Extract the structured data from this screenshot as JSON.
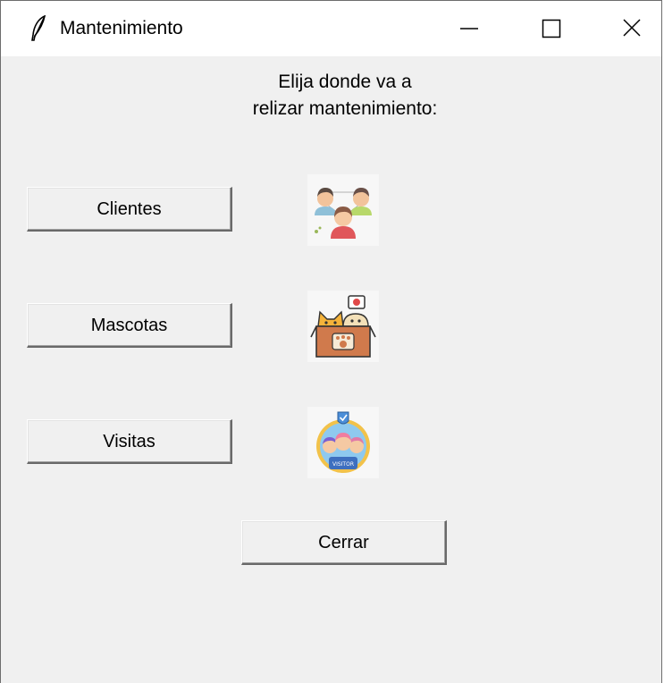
{
  "window": {
    "title": "Mantenimiento",
    "controls": [
      "minimize",
      "maximize",
      "close"
    ]
  },
  "prompt": {
    "text": "Elija donde va a\nrelizar mantenimiento:"
  },
  "buttons": {
    "clientes": "Clientes",
    "mascotas": "Mascotas",
    "visitas": "Visitas",
    "cerrar": "Cerrar"
  },
  "icons": {
    "clientes": "people-group-icon",
    "mascotas": "pets-box-icon",
    "visitas": "visitor-badge-icon",
    "visitor_badge_text": "VISITOR"
  },
  "colors": {
    "window_bg": "#f0f0f0",
    "titlebar_bg": "#ffffff"
  }
}
